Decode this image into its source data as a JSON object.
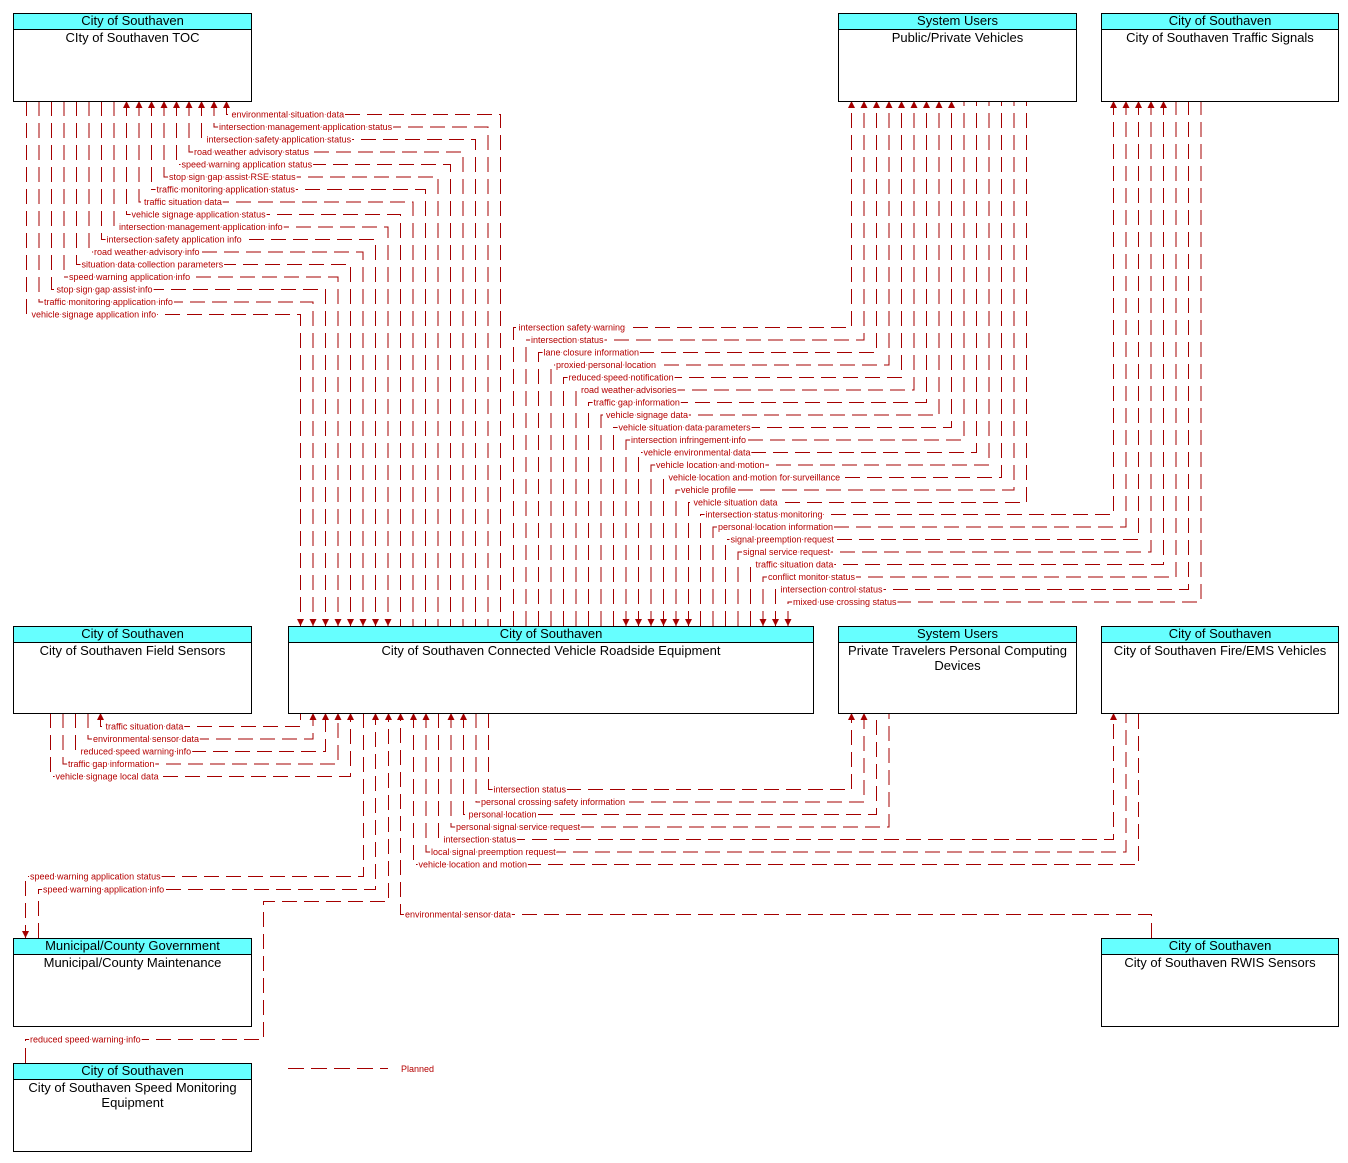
{
  "colors": {
    "flow_line": "#a50000",
    "flow_text": "#b40000",
    "element_header": "#66ffff",
    "element_border": "#000000"
  },
  "diagram": {
    "elements": [
      {
        "id": "toc",
        "stakeholder": "City of Southaven",
        "name": "CIty of Southaven TOC"
      },
      {
        "id": "ppv",
        "stakeholder": "System Users",
        "name": "Public/Private Vehicles"
      },
      {
        "id": "ts",
        "stakeholder": "City of Southaven",
        "name": "City of Southaven Traffic Signals"
      },
      {
        "id": "fs",
        "stakeholder": "City of Southaven",
        "name": "City of Southaven Field Sensors"
      },
      {
        "id": "rse",
        "stakeholder": "City of Southaven",
        "name": "City of Southaven Connected Vehicle Roadside Equipment"
      },
      {
        "id": "ptpcd",
        "stakeholder": "System Users",
        "name": "Private Travelers Personal Computing Devices"
      },
      {
        "id": "fire",
        "stakeholder": "City of Southaven",
        "name": "City of Southaven Fire/EMS Vehicles"
      },
      {
        "id": "muni",
        "stakeholder": "Municipal/County Government",
        "name": "Municipal/County Maintenance"
      },
      {
        "id": "rwis",
        "stakeholder": "City of Southaven",
        "name": "City of Southaven RWIS Sensors"
      },
      {
        "id": "sm",
        "stakeholder": "City of Southaven",
        "name": "City of Southaven Speed Monitoring Equipment"
      }
    ],
    "flows": [
      {
        "from": "rse",
        "to": "toc",
        "label": "environmental situation data",
        "status": "planned"
      },
      {
        "from": "rse",
        "to": "toc",
        "label": "intersection management application status",
        "status": "planned"
      },
      {
        "from": "rse",
        "to": "toc",
        "label": "intersection safety application status",
        "status": "planned"
      },
      {
        "from": "rse",
        "to": "toc",
        "label": "road weather advisory status",
        "status": "planned"
      },
      {
        "from": "rse",
        "to": "toc",
        "label": "speed warning application status",
        "status": "planned"
      },
      {
        "from": "rse",
        "to": "toc",
        "label": "stop sign gap assist RSE status",
        "status": "planned"
      },
      {
        "from": "rse",
        "to": "toc",
        "label": "traffic monitoring application status",
        "status": "planned"
      },
      {
        "from": "rse",
        "to": "toc",
        "label": "traffic situation data",
        "status": "planned"
      },
      {
        "from": "rse",
        "to": "toc",
        "label": "vehicle signage application status",
        "status": "planned"
      },
      {
        "from": "toc",
        "to": "rse",
        "label": "intersection management application info",
        "status": "planned"
      },
      {
        "from": "toc",
        "to": "rse",
        "label": "intersection safety application info",
        "status": "planned"
      },
      {
        "from": "toc",
        "to": "rse",
        "label": "road weather advisory info",
        "status": "planned"
      },
      {
        "from": "toc",
        "to": "rse",
        "label": "situation data collection parameters",
        "status": "planned"
      },
      {
        "from": "toc",
        "to": "rse",
        "label": "speed warning application info",
        "status": "planned"
      },
      {
        "from": "toc",
        "to": "rse",
        "label": "stop sign gap assist info",
        "status": "planned"
      },
      {
        "from": "toc",
        "to": "rse",
        "label": "traffic monitoring application info",
        "status": "planned"
      },
      {
        "from": "toc",
        "to": "rse",
        "label": "vehicle signage application info",
        "status": "planned"
      },
      {
        "from": "rse",
        "to": "ppv",
        "label": "intersection safety warning",
        "status": "planned"
      },
      {
        "from": "rse",
        "to": "ppv",
        "label": "intersection status",
        "status": "planned"
      },
      {
        "from": "rse",
        "to": "ppv",
        "label": "lane closure information",
        "status": "planned"
      },
      {
        "from": "rse",
        "to": "ppv",
        "label": "proxied personal location",
        "status": "planned"
      },
      {
        "from": "rse",
        "to": "ppv",
        "label": "reduced speed notification",
        "status": "planned"
      },
      {
        "from": "rse",
        "to": "ppv",
        "label": "road weather advisories",
        "status": "planned"
      },
      {
        "from": "rse",
        "to": "ppv",
        "label": "traffic gap information",
        "status": "planned"
      },
      {
        "from": "rse",
        "to": "ppv",
        "label": "vehicle signage data",
        "status": "planned"
      },
      {
        "from": "rse",
        "to": "ppv",
        "label": "vehicle situation data parameters",
        "status": "planned"
      },
      {
        "from": "ppv",
        "to": "rse",
        "label": "intersection infringement info",
        "status": "planned"
      },
      {
        "from": "ppv",
        "to": "rse",
        "label": "vehicle environmental data",
        "status": "planned"
      },
      {
        "from": "ppv",
        "to": "rse",
        "label": "vehicle location and motion",
        "status": "planned"
      },
      {
        "from": "ppv",
        "to": "rse",
        "label": "vehicle location and motion for surveillance",
        "status": "planned"
      },
      {
        "from": "ppv",
        "to": "rse",
        "label": "vehicle profile",
        "status": "planned"
      },
      {
        "from": "ppv",
        "to": "rse",
        "label": "vehicle situation data",
        "status": "planned"
      },
      {
        "from": "rse",
        "to": "ts",
        "label": "intersection status monitoring",
        "status": "planned"
      },
      {
        "from": "rse",
        "to": "ts",
        "label": "personal location information",
        "status": "planned"
      },
      {
        "from": "rse",
        "to": "ts",
        "label": "signal preemption request",
        "status": "planned"
      },
      {
        "from": "rse",
        "to": "ts",
        "label": "signal service request",
        "status": "planned"
      },
      {
        "from": "rse",
        "to": "ts",
        "label": "traffic situation data",
        "status": "planned"
      },
      {
        "from": "ts",
        "to": "rse",
        "label": "conflict monitor status",
        "status": "planned"
      },
      {
        "from": "ts",
        "to": "rse",
        "label": "intersection control status",
        "status": "planned"
      },
      {
        "from": "ts",
        "to": "rse",
        "label": "mixed use crossing status",
        "status": "planned"
      },
      {
        "from": "rse",
        "to": "fs",
        "label": "traffic situation data",
        "status": "planned"
      },
      {
        "from": "fs",
        "to": "rse",
        "label": "environmental sensor data",
        "status": "planned"
      },
      {
        "from": "fs",
        "to": "rse",
        "label": "reduced speed warning info",
        "status": "planned"
      },
      {
        "from": "fs",
        "to": "rse",
        "label": "traffic gap information",
        "status": "planned"
      },
      {
        "from": "fs",
        "to": "rse",
        "label": "vehicle signage local data",
        "status": "planned"
      },
      {
        "from": "rse",
        "to": "ptpcd",
        "label": "intersection status",
        "status": "planned"
      },
      {
        "from": "rse",
        "to": "ptpcd",
        "label": "personal crossing safety information",
        "status": "planned"
      },
      {
        "from": "ptpcd",
        "to": "rse",
        "label": "personal location",
        "status": "planned"
      },
      {
        "from": "ptpcd",
        "to": "rse",
        "label": "personal signal service request",
        "status": "planned"
      },
      {
        "from": "rse",
        "to": "fire",
        "label": "intersection status",
        "status": "planned"
      },
      {
        "from": "fire",
        "to": "rse",
        "label": "local signal preemption request",
        "status": "planned"
      },
      {
        "from": "fire",
        "to": "rse",
        "label": "vehicle location and motion",
        "status": "planned"
      },
      {
        "from": "rse",
        "to": "muni",
        "label": "speed warning application status",
        "status": "planned"
      },
      {
        "from": "muni",
        "to": "rse",
        "label": "speed warning application info",
        "status": "planned"
      },
      {
        "from": "rwis",
        "to": "rse",
        "label": "environmental sensor data",
        "status": "planned"
      },
      {
        "from": "sm",
        "to": "rse",
        "label": "reduced speed warning info",
        "status": "planned"
      }
    ]
  },
  "legend": {
    "items": [
      {
        "label": "Planned",
        "style": "dashed"
      }
    ]
  }
}
